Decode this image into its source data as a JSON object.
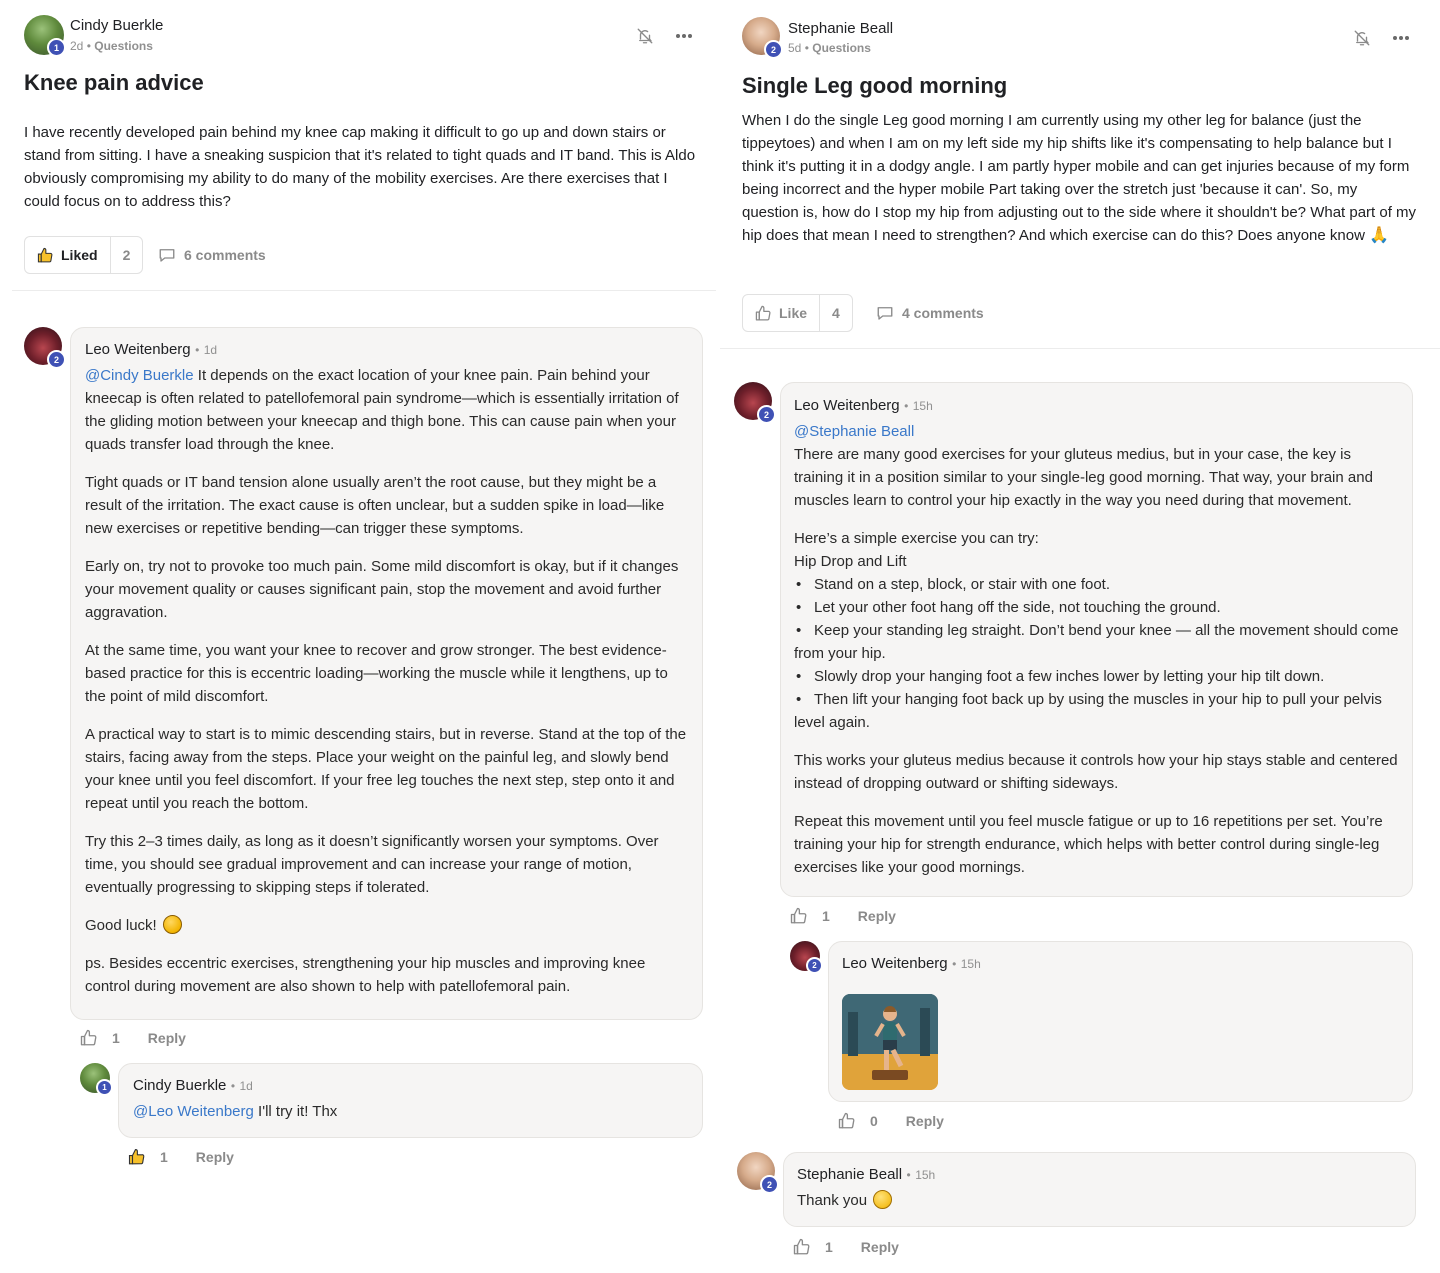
{
  "left_post": {
    "author": "Cindy Buerkle",
    "level": "1",
    "age": "2d",
    "category": "Questions",
    "title": "Knee pain advice",
    "body": "I have recently developed pain behind my knee cap making it difficult to go up and down stairs or stand from sitting. I have a sneaking suspicion that it's related to tight quads and IT band. This is Aldo obviously compromising my ability to do many of the mobility exercises. Are there exercises that I could focus on to address this?",
    "like_label": "Liked",
    "like_count": "2",
    "comments_label": "6 comments",
    "comments": [
      {
        "author": "Leo Weitenberg",
        "level": "2",
        "time": "1d",
        "mention": "@Cindy Buerkle",
        "paragraphs": [
          "It depends on the exact location of your knee pain. Pain behind your kneecap is often related to patellofemoral pain syndrome—which is essentially irritation of the gliding motion between your kneecap and thigh bone. This can cause pain when your quads transfer load through the knee.",
          "Tight quads or IT band tension alone usually aren’t the root cause, but they might be a result of the irritation. The exact cause is often unclear, but a sudden spike in load—like new exercises or repetitive bending—can trigger these symptoms.",
          "Early on, try not to provoke too much pain. Some mild discomfort is okay, but if it changes your movement quality or causes significant pain, stop the movement and avoid further aggravation.",
          "At the same time, you want your knee to recover and grow stronger. The best evidence-based practice for this is eccentric loading—working the muscle while it lengthens, up to the point of mild discomfort.",
          "A practical way to start is to mimic descending stairs, but in reverse. Stand at the top of the stairs, facing away from the steps. Place your weight on the painful leg, and slowly bend your knee until you feel discomfort. If your free leg touches the next step, step onto it and repeat until you reach the bottom.",
          "Try this 2–3 times daily, as long as it doesn’t significantly worsen your symptoms. Over time, you should see gradual improvement and can increase your range of motion, eventually progressing to skipping steps if tolerated.",
          "Good luck!",
          "ps. Besides eccentric exercises, strengthening your hip muscles and improving knee control during movement are also shown to help with patellofemoral pain."
        ],
        "like_count": "1",
        "reply_label": "Reply"
      },
      {
        "author": "Cindy Buerkle",
        "level": "1",
        "time": "1d",
        "mention": "@Leo Weitenberg",
        "text": "I'll try it! Thx",
        "like_count": "1",
        "reply_label": "Reply"
      }
    ]
  },
  "right_post": {
    "author": "Stephanie Beall",
    "level": "2",
    "age": "5d",
    "category": "Questions",
    "title": "Single Leg good morning",
    "body": "When I do the single Leg good morning I am currently using my other leg for balance (just the tippeytoes) and when I am on my left side my hip shifts like it's compensating to help balance but I think it's putting it in a dodgy angle. I am partly hyper mobile and can get injuries because of my form being incorrect and the hyper mobile Part taking over the stretch just 'because it can'. So, my question is, how do I stop my hip from adjusting out to the side where it shouldn't be? What part of my hip does that mean I need to strengthen? And which exercise can do this? Does anyone know",
    "body_emoji": "🙏",
    "like_label": "Like",
    "like_count": "4",
    "comments_label": "4 comments",
    "comments": [
      {
        "author": "Leo Weitenberg",
        "level": "2",
        "time": "15h",
        "mention": "@Stephanie Beall",
        "intro": "There are many good exercises for your gluteus medius, but in your case, the key is training it in a position similar to your single-leg good morning. That way, your brain and muscles learn to control your hip exactly in the way you need during that movement.",
        "try_line": "Here’s a simple exercise you can try:",
        "exercise_name": "Hip Drop and Lift",
        "steps": [
          "Stand on a step, block, or stair with one foot.",
          "Let your other foot hang off the side, not touching the ground.",
          "Keep your standing leg straight. Don’t bend your knee — all the movement should come from your hip.",
          "Slowly drop your hanging foot a few inches lower by letting your hip tilt down.",
          "Then lift your hanging foot back up by using the muscles in your hip to pull your pelvis level again."
        ],
        "outro_1": "This works your gluteus medius because it controls how your hip stays stable and centered instead of dropping outward or shifting sideways.",
        "outro_2": "Repeat this movement until you feel muscle fatigue or up to 16 repetitions per set. You’re training your hip for strength endurance, which helps with better control during single-leg exercises like your good mornings.",
        "like_count": "1",
        "reply_label": "Reply"
      },
      {
        "author": "Leo Weitenberg",
        "level": "2",
        "time": "15h",
        "like_count": "0",
        "reply_label": "Reply"
      },
      {
        "author": "Stephanie Beall",
        "level": "2",
        "time": "15h",
        "text": "Thank you",
        "like_count": "1",
        "reply_label": "Reply"
      }
    ]
  },
  "separator": "•"
}
